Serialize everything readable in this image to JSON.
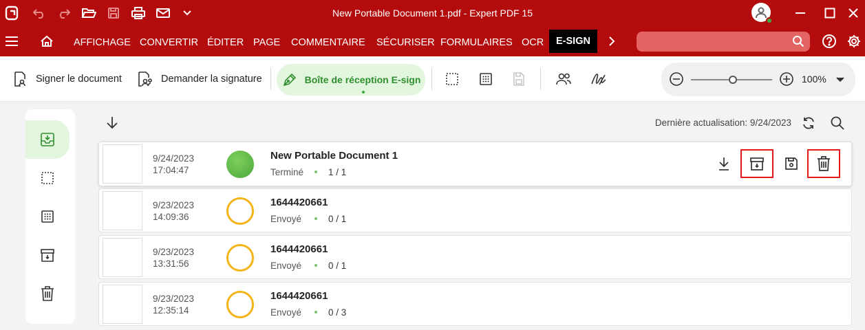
{
  "titlebar": {
    "title": "New Portable Document 1.pdf   -   Expert PDF 15",
    "icons": [
      "app-logo-icon",
      "undo-icon",
      "redo-icon",
      "open-folder-icon",
      "save-icon",
      "print-icon",
      "email-icon",
      "chevron-down-icon",
      "user-icon",
      "minimize-icon",
      "maximize-icon",
      "close-icon"
    ]
  },
  "menu": {
    "items": [
      "AFFICHAGE",
      "CONVERTIR",
      "ÉDITER",
      "PAGE",
      "COMMENTAIRE",
      "SÉCURISER",
      "FORMULAIRES",
      "OCR",
      "E-SIGN"
    ],
    "active": "E-SIGN",
    "search_placeholder": ""
  },
  "toolbar": {
    "sign_label": "Signer le document",
    "request_label": "Demander la signature",
    "inbox_label": "Boîte de réception E-sign",
    "zoom_value": "100%"
  },
  "list": {
    "last_refresh": "Dernière actualisation: 9/24/2023",
    "rows": [
      {
        "date": "9/24/2023",
        "time": "17:04:47",
        "name": "New Portable Document 1",
        "status": "Terminé",
        "count": "1 / 1",
        "state": "done"
      },
      {
        "date": "9/23/2023",
        "time": "14:09:36",
        "name": "1644420661",
        "status": "Envoyé",
        "count": "0 / 1",
        "state": "sent"
      },
      {
        "date": "9/23/2023",
        "time": "13:31:56",
        "name": "1644420661",
        "status": "Envoyé",
        "count": "0 / 1",
        "state": "sent"
      },
      {
        "date": "9/23/2023",
        "time": "12:35:14",
        "name": "1644420661",
        "status": "Envoyé",
        "count": "0 / 3",
        "state": "sent"
      }
    ]
  },
  "colors": {
    "brand_red": "#b40c0c",
    "active_green": "#2f8f2f",
    "done_green": "#5cb84a",
    "sent_yellow": "#f3b519",
    "highlight_red": "#e01818"
  }
}
